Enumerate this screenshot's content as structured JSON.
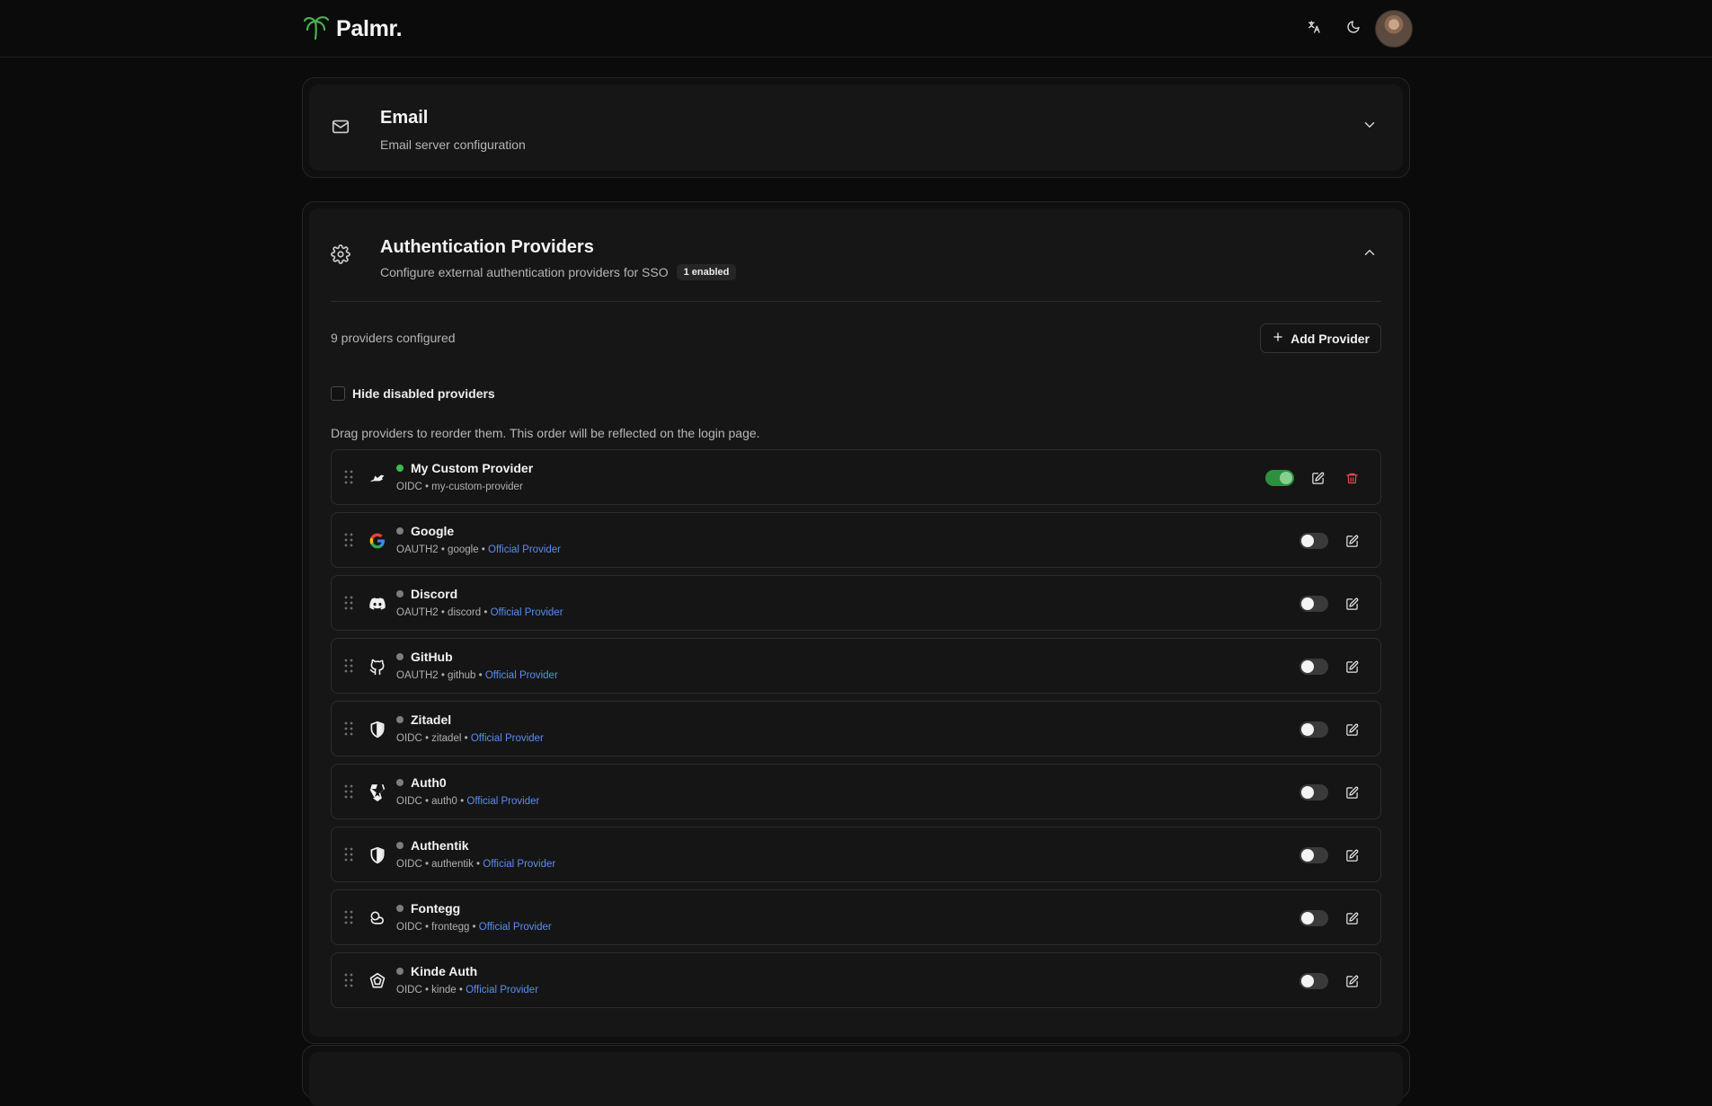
{
  "header": {
    "brand": "Palmr.",
    "icons": {
      "logo": "palm-tree-icon",
      "translate": "translate-icon",
      "theme": "moon-icon"
    }
  },
  "email_section": {
    "title": "Email",
    "description": "Email server configuration",
    "icon": "mail-icon",
    "expanded": false
  },
  "auth_section": {
    "title": "Authentication Providers",
    "description": "Configure external authentication providers for SSO",
    "badge": "1 enabled",
    "icon": "gear-icon",
    "expanded": true,
    "count_text": "9 providers configured",
    "add_button": "Add Provider",
    "hide_disabled_label": "Hide disabled providers",
    "hide_disabled_checked": false,
    "drag_hint": "Drag providers to reorder them. This order will be reflected on the login page.",
    "providers": [
      {
        "name": "My Custom Provider",
        "type": "OIDC",
        "slug": "my-custom-provider",
        "official": "",
        "enabled": true,
        "icon": "custom-provider-icon",
        "deletable": true
      },
      {
        "name": "Google",
        "type": "OAUTH2",
        "slug": "google",
        "official": "Official Provider",
        "enabled": false,
        "icon": "google-icon",
        "deletable": false
      },
      {
        "name": "Discord",
        "type": "OAUTH2",
        "slug": "discord",
        "official": "Official Provider",
        "enabled": false,
        "icon": "discord-icon",
        "deletable": false
      },
      {
        "name": "GitHub",
        "type": "OAUTH2",
        "slug": "github",
        "official": "Official Provider",
        "enabled": false,
        "icon": "github-icon",
        "deletable": false
      },
      {
        "name": "Zitadel",
        "type": "OIDC",
        "slug": "zitadel",
        "official": "Official Provider",
        "enabled": false,
        "icon": "zitadel-shield-icon",
        "deletable": false
      },
      {
        "name": "Auth0",
        "type": "OIDC",
        "slug": "auth0",
        "official": "Official Provider",
        "enabled": false,
        "icon": "auth0-icon",
        "deletable": false
      },
      {
        "name": "Authentik",
        "type": "OIDC",
        "slug": "authentik",
        "official": "Official Provider",
        "enabled": false,
        "icon": "authentik-shield-icon",
        "deletable": false
      },
      {
        "name": "Fontegg",
        "type": "OIDC",
        "slug": "frontegg",
        "official": "Official Provider",
        "enabled": false,
        "icon": "frontegg-icon",
        "deletable": false
      },
      {
        "name": "Kinde Auth",
        "type": "OIDC",
        "slug": "kinde",
        "official": "Official Provider",
        "enabled": false,
        "icon": "kinde-icon",
        "deletable": false
      }
    ]
  },
  "colors": {
    "accent_green": "#3fb950",
    "link_blue": "#5b8def",
    "danger": "#e5484d",
    "background": "#0b0b0b"
  }
}
